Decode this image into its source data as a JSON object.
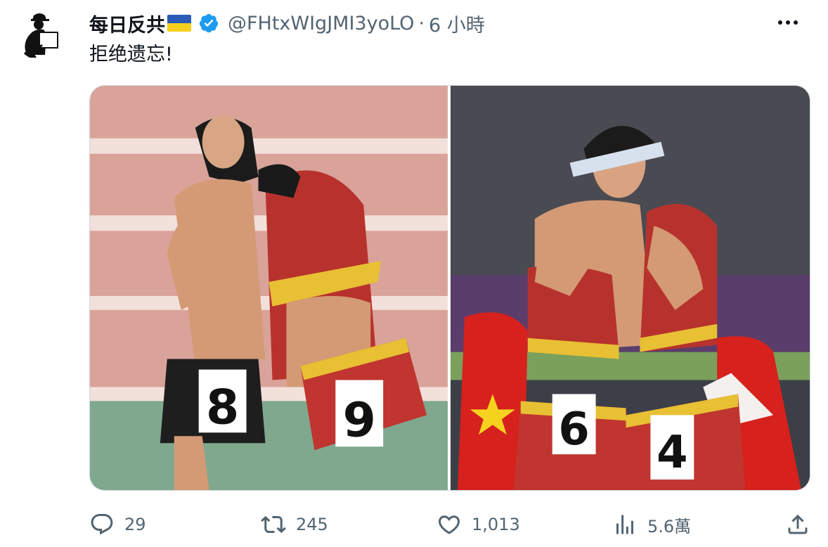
{
  "author": {
    "display_name": "每日反共",
    "flag_icon": "ukraine-flag-icon",
    "verified_icon": "verified-badge-icon",
    "handle": "@FHtxWIgJMI3yoLO",
    "separator": "·",
    "time": "6 小時"
  },
  "tweet": {
    "text": "拒绝遗忘!"
  },
  "media": {
    "left_photo": {
      "bib_left": "8",
      "bib_right": "9"
    },
    "right_photo": {
      "bib_left": "6",
      "bib_right": "4"
    }
  },
  "actions": {
    "reply_count": "29",
    "retweet_count": "245",
    "like_count": "1,013",
    "views_count": "5.6萬"
  },
  "colors": {
    "text": "#0f1419",
    "muted": "#536471",
    "verified": "#1d9bf0"
  }
}
